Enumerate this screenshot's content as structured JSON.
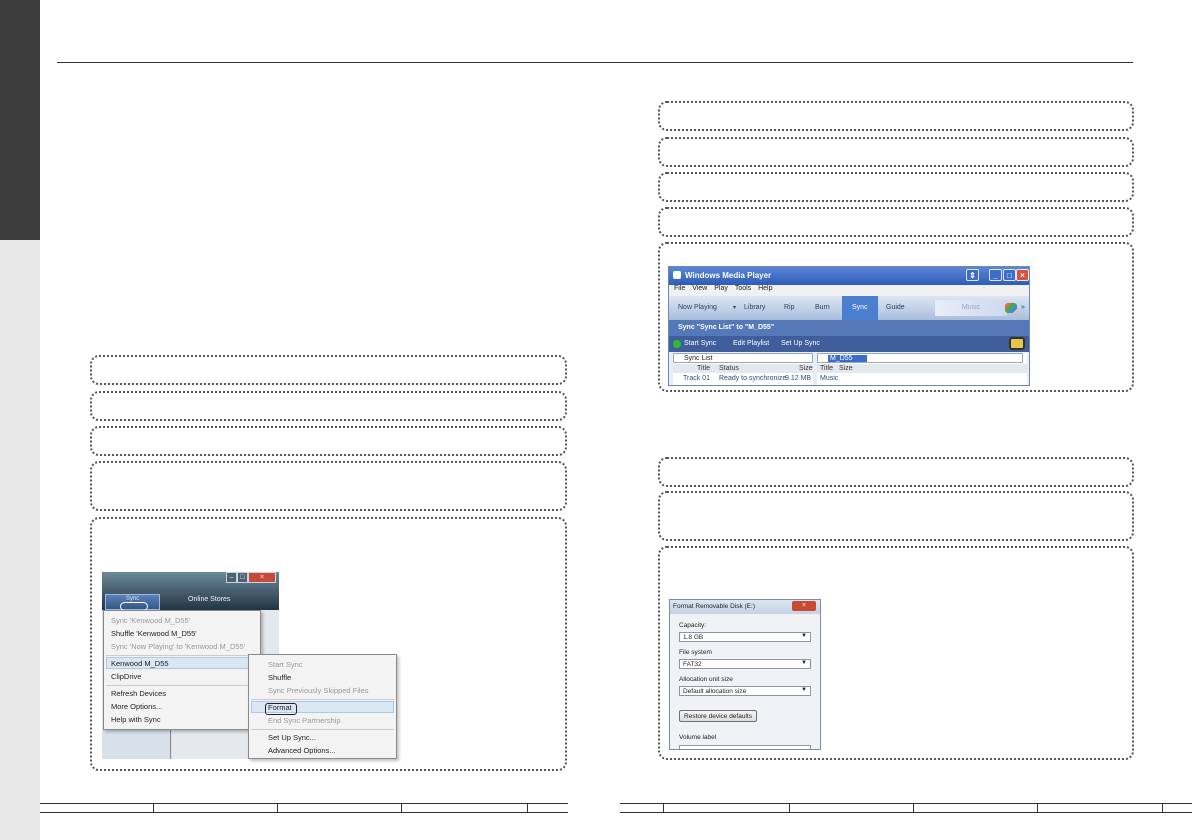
{
  "wmp": {
    "title": "Windows Media Player",
    "menu": [
      "File",
      "View",
      "Play",
      "Tools",
      "Help"
    ],
    "tabs": [
      "Now Playing",
      "Library",
      "Rip",
      "Burn",
      "Sync",
      "Guide"
    ],
    "active_tab": "Sync",
    "music_label": "Music",
    "more_arrows": "»",
    "sync_header": "Sync \"Sync List\" to \"M_D55\"",
    "toolbar": {
      "start_sync": "Start Sync",
      "edit_playlist": "Edit Playlist",
      "set_up_sync": "Set Up Sync"
    },
    "left_list": {
      "dropdown": "Sync List",
      "columns": [
        "Title",
        "Status",
        "Size"
      ],
      "row": {
        "title": "Track 01",
        "status": "Ready to synchronize",
        "size": "9.12 MB"
      }
    },
    "right_list": {
      "dropdown": "M_D55",
      "columns": [
        "Title",
        "Size"
      ],
      "row": "Music"
    },
    "window_buttons": {
      "min": "_",
      "max": "□",
      "close": "×",
      "switch": "⇕"
    }
  },
  "vista": {
    "sync_tab": "Sync",
    "online_stores": "Online Stores",
    "window_buttons": {
      "min": "–",
      "max": "□",
      "close": "×"
    },
    "menu": [
      {
        "label": "Sync 'Kenwood M_D55'",
        "disabled": true
      },
      {
        "label": "Shuffle 'Kenwood M_D55'",
        "disabled": false
      },
      {
        "label": "Sync 'Now Playing' to 'Kenwood M_D55'",
        "disabled": true
      },
      {
        "label": "Kenwood M_D55",
        "disabled": false,
        "submenu": true,
        "highlighted": true
      },
      {
        "label": "ClipDrive",
        "disabled": false,
        "submenu": true
      },
      {
        "label": "Refresh Devices",
        "disabled": false
      },
      {
        "label": "More Options...",
        "disabled": false
      },
      {
        "label": "Help with Sync",
        "disabled": false
      }
    ],
    "submenu": [
      {
        "label": "Start Sync",
        "disabled": true
      },
      {
        "label": "Shuffle",
        "disabled": false
      },
      {
        "label": "Sync Previously Skipped Files",
        "disabled": true
      },
      {
        "label": "Format",
        "disabled": false,
        "highlighted": true
      },
      {
        "label": "End Sync Partnership",
        "disabled": true
      },
      {
        "label": "Set Up Sync...",
        "disabled": false
      },
      {
        "label": "Advanced Options...",
        "disabled": false
      }
    ]
  },
  "format_dialog": {
    "title": "Format Removable Disk (E:)",
    "close": "×",
    "capacity_label": "Capacity:",
    "capacity_value": "1.8 GB",
    "fs_label": "File system",
    "fs_value": "FAT32",
    "alloc_label": "Allocation unit size",
    "alloc_value": "Default allocation size",
    "restore_button": "Restore device defaults",
    "volume_label": "Volume label"
  },
  "colors": {
    "side_tab": "#3d3d3d",
    "side_strip": "#e6e6e6",
    "wmp_active_tab": "#4c7ed0"
  }
}
